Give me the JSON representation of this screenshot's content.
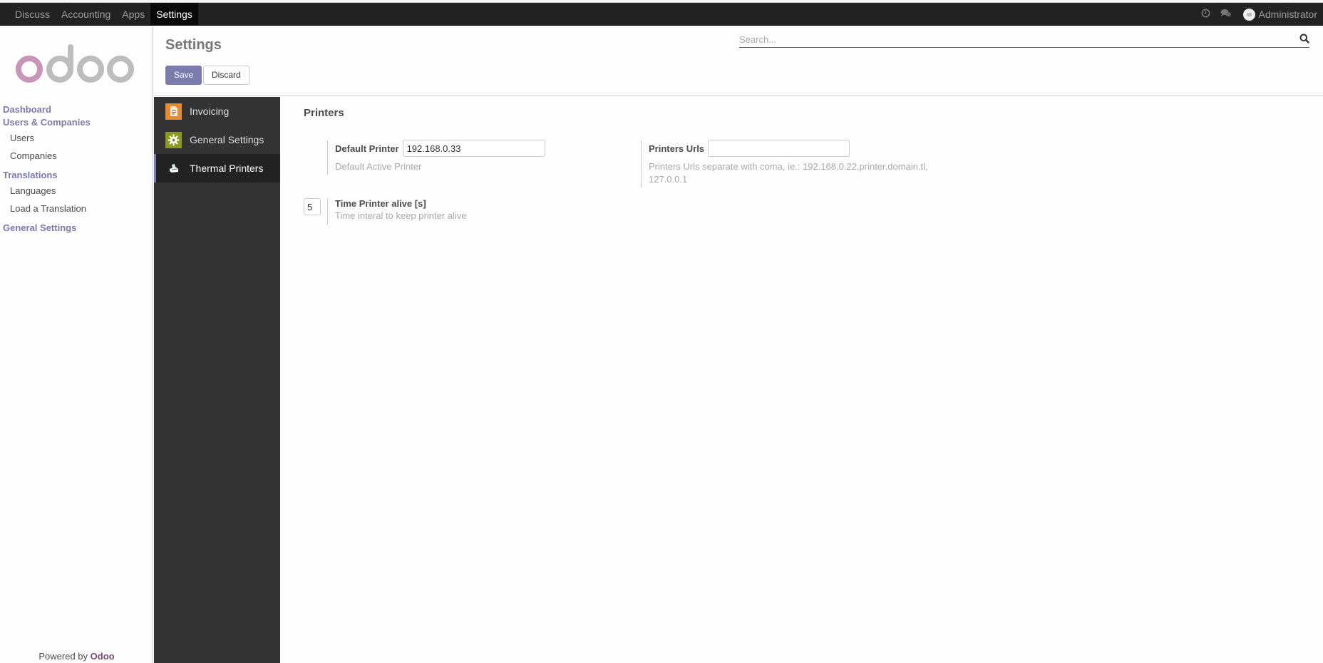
{
  "topbar": {
    "menu": [
      {
        "label": "Discuss",
        "active": false
      },
      {
        "label": "Accounting",
        "active": false
      },
      {
        "label": "Apps",
        "active": false
      },
      {
        "label": "Settings",
        "active": true
      }
    ],
    "icons": [
      "clock-icon",
      "chat-icon"
    ],
    "user": "Administrator"
  },
  "sidebar": {
    "logo_text": "odoo",
    "items": [
      {
        "label": "Dashboard",
        "type": "head"
      },
      {
        "label": "Users & Companies",
        "type": "head"
      },
      {
        "label": "Users",
        "type": "sub"
      },
      {
        "label": "Companies",
        "type": "sub"
      },
      {
        "label": "Translations",
        "type": "head"
      },
      {
        "label": "Languages",
        "type": "sub"
      },
      {
        "label": "Load a Translation",
        "type": "sub"
      },
      {
        "label": "General Settings",
        "type": "head"
      }
    ],
    "powered_by": "Powered by",
    "powered_brand": "Odoo"
  },
  "control": {
    "title": "Settings",
    "save_label": "Save",
    "discard_label": "Discard",
    "search_placeholder": "Search..."
  },
  "apps": [
    {
      "label": "Invoicing",
      "icon": "invoice-icon",
      "active": false
    },
    {
      "label": "General Settings",
      "icon": "gear-icon",
      "active": false
    },
    {
      "label": "Thermal Printers",
      "icon": "printer-icon",
      "active": true
    }
  ],
  "printers": {
    "section_title": "Printers",
    "default_printer": {
      "label": "Default Printer",
      "value": "192.168.0.33",
      "help": "Default Active Printer"
    },
    "printers_urls": {
      "label": "Printers Urls",
      "value": "",
      "help": "Printers Urls separate with coma, ie.: 192.168.0.22,printer.domain.tl, 127.0.0.1"
    },
    "time_alive": {
      "label": "Time Printer alive [s]",
      "value": "5",
      "help": "Time interal to keep printer alive"
    }
  },
  "colors": {
    "brand": "#7c7bad",
    "topbar": "#222222",
    "apps_panel": "#333333"
  }
}
